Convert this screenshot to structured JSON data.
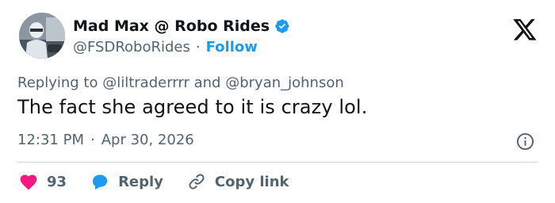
{
  "author": {
    "display_name": "Mad Max @ Robo Rides",
    "handle": "@FSDRoboRides",
    "separator": "·",
    "follow_label": "Follow"
  },
  "tweet": {
    "replying_prefix": "Replying to",
    "mention_1": "@liltraderrrr",
    "and_word": "and",
    "mention_2": "@bryan_johnson",
    "text": "The fact she agreed to it is crazy lol.",
    "time": "12:31 PM",
    "date_separator": "·",
    "date": "Apr 30, 2026"
  },
  "actions": {
    "like_count": "93",
    "reply_label": "Reply",
    "copy_link_label": "Copy link"
  },
  "colors": {
    "accent": "#1d9bf0",
    "like": "#f91880",
    "text_primary": "#0f1419",
    "text_secondary": "#536471",
    "divider": "#cfd9de"
  },
  "icons": [
    "verified-badge-icon",
    "x-logo-icon",
    "info-icon",
    "heart-icon",
    "reply-bubble-icon",
    "link-icon"
  ]
}
